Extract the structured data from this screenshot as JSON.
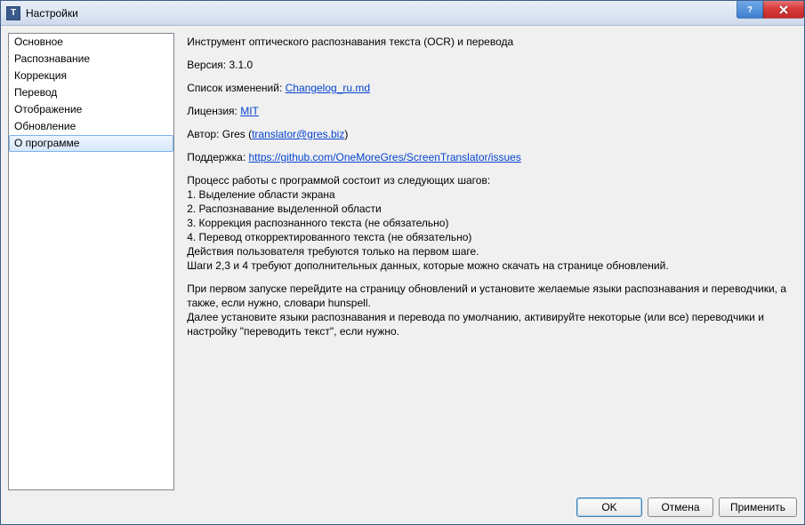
{
  "window": {
    "title": "Настройки"
  },
  "sidebar": {
    "items": [
      {
        "label": "Основное",
        "selected": false
      },
      {
        "label": "Распознавание",
        "selected": false
      },
      {
        "label": "Коррекция",
        "selected": false
      },
      {
        "label": "Перевод",
        "selected": false
      },
      {
        "label": "Отображение",
        "selected": false
      },
      {
        "label": "Обновление",
        "selected": false
      },
      {
        "label": "О программе",
        "selected": true
      }
    ]
  },
  "about": {
    "description": "Инструмент оптического распознавания текста (OCR) и перевода",
    "version_label": "Версия:",
    "version_value": "3.1.0",
    "changelog_label": "Список изменений:",
    "changelog_link": "Changelog_ru.md",
    "license_label": "Лицензия:",
    "license_link": "MIT",
    "author_label": "Автор:",
    "author_name": "Gres",
    "author_email": "translator@gres.biz",
    "support_label": "Поддержка:",
    "support_link": "https://github.com/OneMoreGres/ScreenTranslator/issues",
    "steps": "Процесс работы с программой состоит из следующих шагов:\n1. Выделение области экрана\n2. Распознавание выделенной области\n3. Коррекция распознанного текста (не обязательно)\n4. Перевод откорректированного текста (не обязательно)\nДействия пользователя требуются только на первом шаге.\nШаги 2,3 и 4 требуют дополнительных данных, которые можно скачать на странице обновлений.",
    "first_run": "При первом запуске перейдите на страницу обновлений и установите желаемые языки распознавания и переводчики, а также, если нужно, словари hunspell.\nДалее установите языки распознавания и перевода по умолчанию, активируйте некоторые (или все) переводчики и настройку \"переводить текст\", если нужно."
  },
  "buttons": {
    "ok": "OK",
    "cancel": "Отмена",
    "apply": "Применить"
  }
}
